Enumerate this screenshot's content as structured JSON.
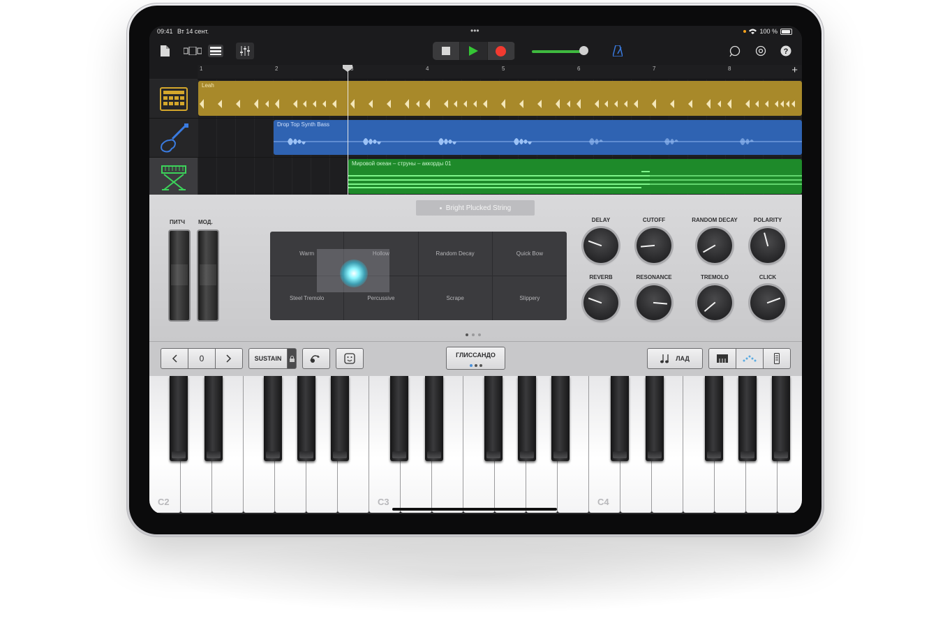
{
  "status": {
    "time": "09:41",
    "date": "Вт 14 сент.",
    "battery": "100 %"
  },
  "ruler": {
    "bars": [
      "1",
      "2",
      "3",
      "4",
      "5",
      "6",
      "7",
      "8"
    ]
  },
  "tracks": [
    {
      "name": "Leah",
      "color": "#c9a227"
    },
    {
      "name": "Drop Top Synth Bass",
      "color": "#2f6fc4"
    },
    {
      "name": "Мировой океан – струны – аккорды 01",
      "color": "#2fa83a"
    }
  ],
  "instrument": {
    "preset": "Bright Plucked String",
    "pitch_label": "ПИТЧ",
    "mod_label": "МОД.",
    "pad": [
      "Warm",
      "Hollow",
      "Random Decay",
      "Quick Bow",
      "Steel Tremolo",
      "Percussive",
      "Scrape",
      "Slippery"
    ],
    "knobs": [
      {
        "label": "DELAY",
        "angle": -70
      },
      {
        "label": "CUTOFF",
        "angle": -95
      },
      {
        "label": "RANDOM DECAY",
        "angle": -120
      },
      {
        "label": "POLARITY",
        "angle": -15
      },
      {
        "label": "REVERB",
        "angle": -70
      },
      {
        "label": "RESONANCE",
        "angle": 95
      },
      {
        "label": "TREMOLO",
        "angle": -130
      },
      {
        "label": "CLICK",
        "angle": 70
      }
    ]
  },
  "controls": {
    "octave_value": "0",
    "sustain": "SUSTAIN",
    "glissando": "ГЛИССАНДО",
    "scale": "ЛАД"
  },
  "keyboard": {
    "notes": [
      "C2",
      "C3",
      "C4"
    ]
  },
  "colors": {
    "accent_green": "#35c635",
    "record_red": "#f23a30",
    "metronome_blue": "#3a7be0"
  }
}
